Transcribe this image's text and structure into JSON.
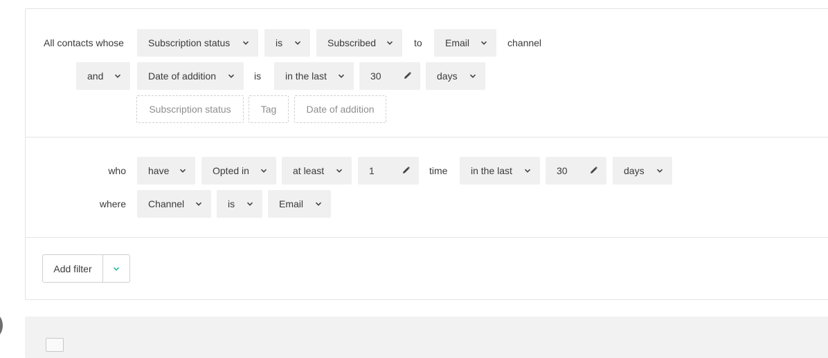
{
  "segment": {
    "row1": {
      "prefix": "All contacts whose",
      "field": "Subscription status",
      "operator": "is",
      "value": "Subscribed",
      "to_label": "to",
      "channel": "Email",
      "suffix": "channel"
    },
    "row2": {
      "conjunction": "and",
      "field": "Date of addition",
      "is_label": "is",
      "operator": "in the last",
      "amount": "30",
      "unit": "days"
    },
    "quick_filters": [
      "Subscription status",
      "Tag",
      "Date of addition"
    ]
  },
  "behavior": {
    "row1": {
      "who_label": "who",
      "verb": "have",
      "action": "Opted in",
      "frequency": "at least",
      "count": "1",
      "time_label": "time",
      "period": "in the last",
      "amount": "30",
      "unit": "days"
    },
    "row2": {
      "where_label": "where",
      "field": "Channel",
      "operator": "is",
      "value": "Email"
    }
  },
  "actions": {
    "add_filter_label": "Add filter",
    "accent_color": "#2bb79a"
  },
  "icons": {
    "chevron": "chevron-down-icon",
    "pencil": "pencil-icon"
  }
}
